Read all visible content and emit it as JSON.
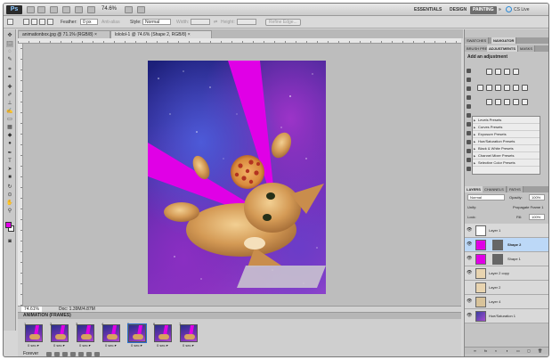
{
  "app": {
    "logo": "Ps",
    "zoom": "74.6%",
    "workspaces": [
      "ESSENTIALS",
      "DESIGN",
      "PAINTING"
    ],
    "active_workspace": "PAINTING",
    "cs_live": "CS Live"
  },
  "options": {
    "feather_label": "Feather:",
    "feather_value": "0 px",
    "antialias_label": "Anti-alias",
    "style_label": "Style:",
    "style_value": "Normal",
    "width_label": "Width:",
    "height_label": "Height:",
    "refine_button": "Refine Edge..."
  },
  "documents": {
    "tabs": [
      "animationbox.jpg @ 71.1% (RGB/8)",
      "lololol-1 @ 74.6% (Shape 2, RGB/8)"
    ],
    "active_index": 1
  },
  "colors": {
    "foreground": "#e000e6",
    "background": "#ffffff",
    "laser": "#e000e6",
    "selection": "#bcd8f7"
  },
  "status": {
    "zoom": "74.61%",
    "doc": "Doc: 1.39M/4.87M"
  },
  "animation": {
    "title": "ANIMATION (FRAMES)",
    "frames": [
      {
        "num": "1",
        "delay": "0 sec.▾"
      },
      {
        "num": "2",
        "delay": "0 sec.▾"
      },
      {
        "num": "3",
        "delay": "0 sec.▾"
      },
      {
        "num": "4",
        "delay": "0 sec.▾"
      },
      {
        "num": "5",
        "delay": "0 sec.▾"
      },
      {
        "num": "6",
        "delay": "0 sec.▾"
      },
      {
        "num": "7",
        "delay": "0 sec.▾"
      }
    ],
    "selected_frame": 5,
    "loop": "Forever"
  },
  "panels": {
    "top_tabs": [
      "SWATCHES",
      "NAVIGATOR"
    ],
    "adj_tabs": [
      "BRUSH PRES",
      "ADJUSTMENTS",
      "MASKS"
    ],
    "add_adjustment": "Add an adjustment",
    "presets": [
      "Levels Presets",
      "Curves Presets",
      "Exposure Presets",
      "Hue/Saturation Presets",
      "Black & White Presets",
      "Channel Mixer Presets",
      "Selective Color Presets"
    ],
    "layer_tabs": [
      "LAYERS",
      "CHANNELS",
      "PATHS"
    ],
    "blend_mode": "Normal",
    "opacity_label": "Opacity:",
    "opacity_value": "100%",
    "unify_label": "Unify:",
    "propagate_label": "Propagate Frame 1",
    "lock_label": "Lock:",
    "fill_label": "Fill:",
    "fill_value": "100%",
    "layers": [
      {
        "name": "Layer 1"
      },
      {
        "name": "Shape 2"
      },
      {
        "name": "Shape 1"
      },
      {
        "name": "Layer 2 copy"
      },
      {
        "name": "Layer 2"
      },
      {
        "name": "Layer 4"
      },
      {
        "name": "Hue/Saturation 1"
      }
    ],
    "selected_layer": 1
  }
}
